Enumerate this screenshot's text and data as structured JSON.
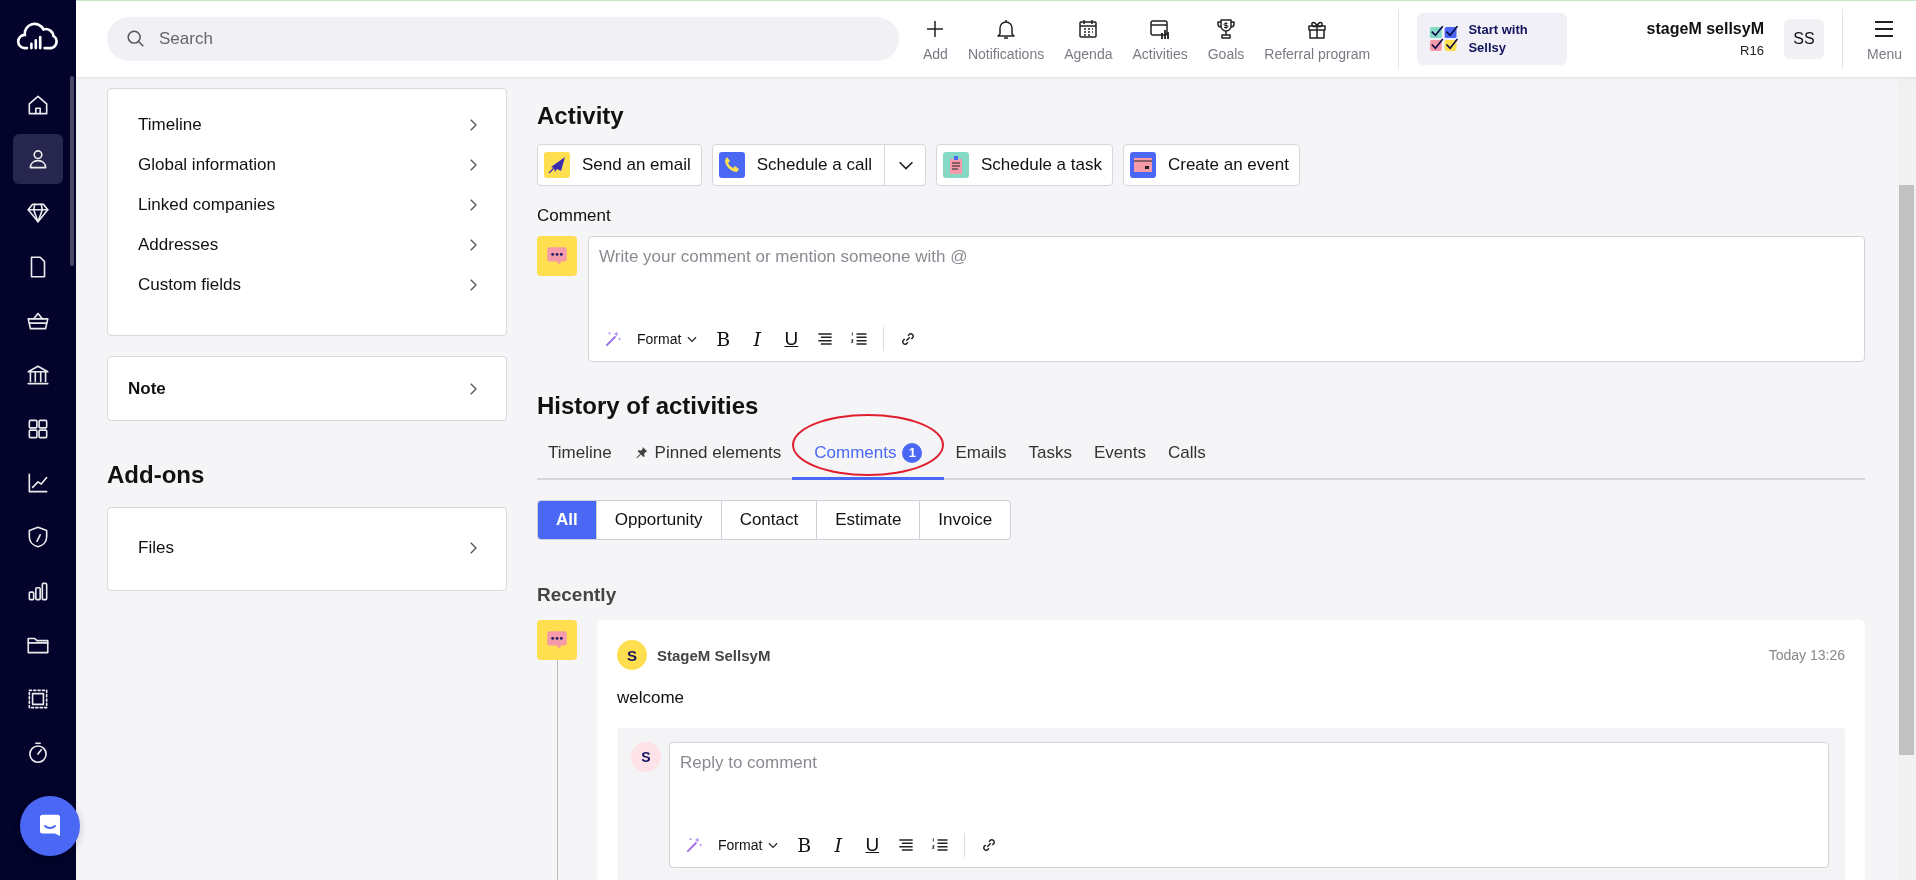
{
  "sidebar": {
    "items": [
      {
        "kind": "home",
        "selected": false
      },
      {
        "kind": "person",
        "selected": true
      },
      {
        "kind": "diamond",
        "selected": false
      },
      {
        "kind": "document",
        "selected": false
      },
      {
        "kind": "basket",
        "selected": false
      },
      {
        "kind": "bank",
        "selected": false
      },
      {
        "kind": "grid",
        "selected": false
      },
      {
        "kind": "chart",
        "selected": false
      },
      {
        "kind": "shield",
        "selected": false
      },
      {
        "kind": "bars",
        "selected": false
      },
      {
        "kind": "folder",
        "selected": false
      },
      {
        "kind": "stamp",
        "selected": false
      },
      {
        "kind": "timer",
        "selected": false
      }
    ]
  },
  "topbar": {
    "search": {
      "placeholder": "Search"
    },
    "actions": [
      {
        "kind": "add",
        "label": "Add"
      },
      {
        "kind": "bell",
        "label": "Notifications"
      },
      {
        "kind": "calendar",
        "label": "Agenda"
      },
      {
        "kind": "activities",
        "label": "Activities"
      },
      {
        "kind": "trophy",
        "label": "Goals"
      },
      {
        "kind": "gift",
        "label": "Referral program"
      }
    ],
    "promo": "Start with Sellsy",
    "user_name": "stageM sellsyM",
    "user_role": "R16",
    "avatar": "SS",
    "menu": "Menu"
  },
  "left": {
    "sections": [
      "Timeline",
      "Global information",
      "Linked companies",
      "Addresses",
      "Custom fields"
    ],
    "note": "Note",
    "addons_title": "Add-ons",
    "addons": [
      "Files"
    ]
  },
  "activity": {
    "title": "Activity",
    "buttons": [
      {
        "kind": "email",
        "label": "Send an email"
      },
      {
        "kind": "call",
        "label": "Schedule a call"
      },
      {
        "kind": "task",
        "label": "Schedule a task"
      },
      {
        "kind": "event",
        "label": "Create an event"
      }
    ],
    "comment_label": "Comment",
    "comment_placeholder": "Write your comment or mention someone with @",
    "format": "Format",
    "tools": [
      "B",
      "I",
      "U"
    ]
  },
  "history": {
    "title": "History of activities",
    "tabs": [
      {
        "kind": "plain",
        "label": "Timeline",
        "selected": false
      },
      {
        "kind": "pinned",
        "label": "Pinned elements",
        "selected": false
      },
      {
        "kind": "plain",
        "label": "Comments",
        "badge": "1",
        "selected": true
      },
      {
        "kind": "plain",
        "label": "Emails",
        "selected": false
      },
      {
        "kind": "plain",
        "label": "Tasks",
        "selected": false
      },
      {
        "kind": "plain",
        "label": "Events",
        "selected": false
      },
      {
        "kind": "plain",
        "label": "Calls",
        "selected": false
      }
    ],
    "filters": [
      {
        "label": "All",
        "selected": true
      },
      {
        "label": "Opportunity",
        "selected": false
      },
      {
        "label": "Contact",
        "selected": false
      },
      {
        "label": "Estimate",
        "selected": false
      },
      {
        "label": "Invoice",
        "selected": false
      }
    ],
    "recently": "Recently",
    "comment": {
      "avatar": "S",
      "author": "StageM SellsyM",
      "time": "Today 13:26",
      "text": "welcome",
      "reply_avatar": "S",
      "reply_placeholder": "Reply to comment",
      "format": "Format",
      "tools": [
        "B",
        "I",
        "U"
      ]
    }
  }
}
